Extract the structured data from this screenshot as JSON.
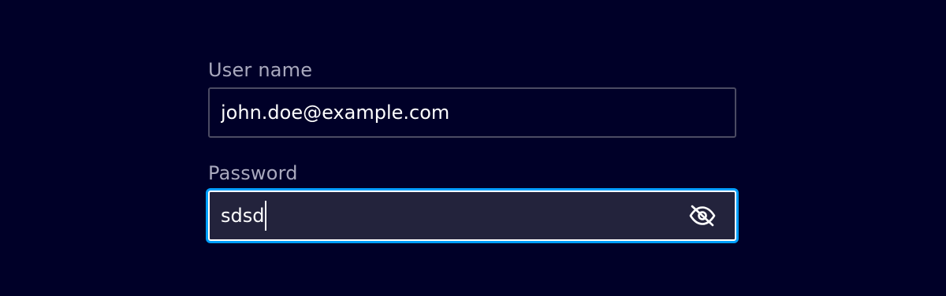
{
  "form": {
    "username": {
      "label": "User name",
      "value": "john.doe@example.com"
    },
    "password": {
      "label": "Password",
      "value": "sdsd",
      "visibility_toggle_icon": "eye-off-icon"
    }
  },
  "colors": {
    "background": "#000028",
    "label": "#a9a9be",
    "text": "#ffffff",
    "input_border": "#4b4b63",
    "focused_input_background": "#23233c",
    "focus_ring": "#009fff"
  }
}
